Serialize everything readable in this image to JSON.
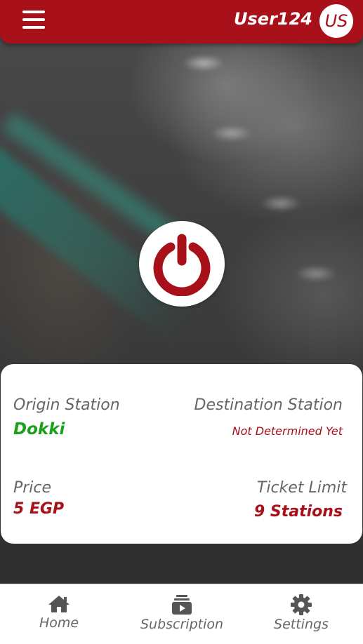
{
  "header": {
    "username": "User124",
    "avatar_initials": "US",
    "brand_color": "#a8101a"
  },
  "power": {
    "icon": "power-icon"
  },
  "trip": {
    "origin_label": "Origin Station",
    "origin_value": "Dokki",
    "destination_label": "Destination Station",
    "destination_value": "Not Determined Yet",
    "price_label": "Price",
    "price_value": "5 EGP",
    "limit_label": "Ticket Limit",
    "limit_value": "9 Stations"
  },
  "colors": {
    "accent_red": "#a8101a",
    "origin_green": "#1aa01a",
    "label_gray": "#666666"
  },
  "nav": {
    "items": [
      {
        "label": "Home",
        "icon": "home-icon"
      },
      {
        "label": "Subscription",
        "icon": "subscription-icon"
      },
      {
        "label": "Settings",
        "icon": "gear-icon"
      }
    ]
  }
}
